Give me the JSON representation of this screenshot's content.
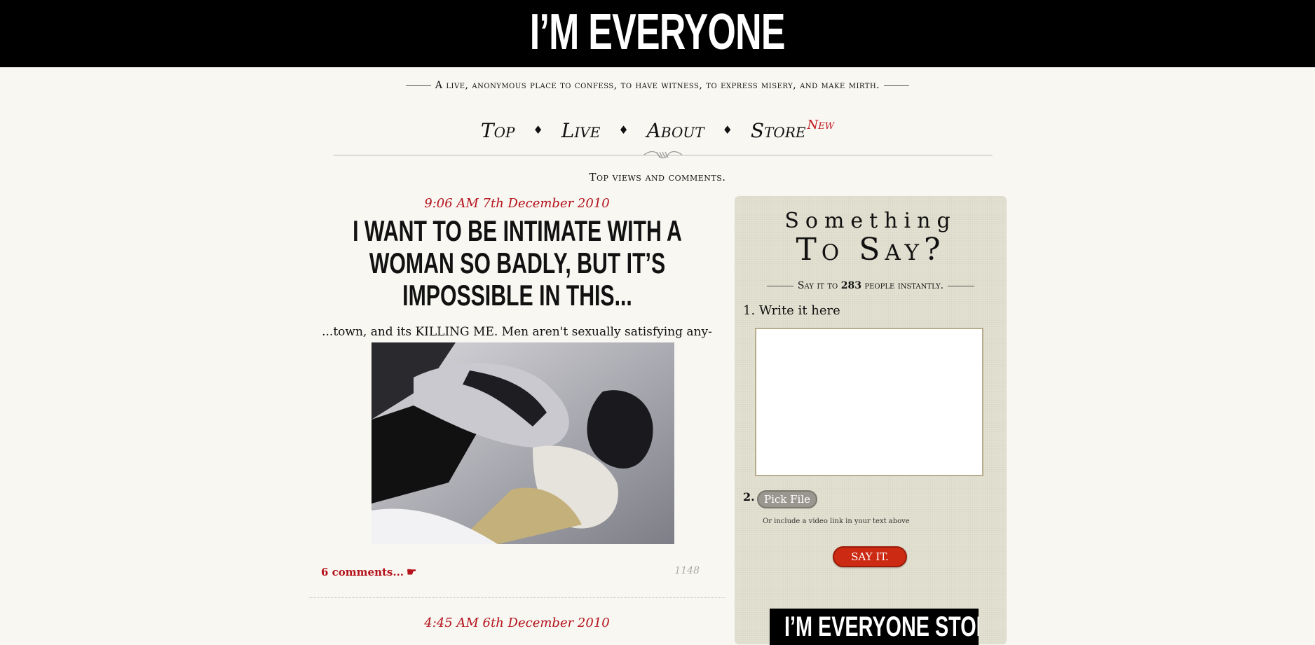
{
  "header": {
    "title": "I’M EVERYONE"
  },
  "tagline": "A live, anonymous place to confess, to have witness, to express misery, and make mirth.",
  "nav": {
    "items": [
      "Top",
      "Live",
      "About",
      "Store"
    ],
    "new_badge": "New"
  },
  "section_caption": "Top views and comments.",
  "post": {
    "time": "9:06 AM 7th December 2010",
    "title": "I WANT TO BE INTIMATE WITH A WOMAN SO BADLY, BUT IT’S IMPOSSIBLE IN THIS...",
    "body": "...town, and its KILLING ME. Men aren't sexually satisfying any-more...",
    "comments_label": "6 comments...",
    "views": "1148"
  },
  "next_post": {
    "time": "4:45 AM 6th December 2010"
  },
  "sidebar": {
    "heading_line1": "Something",
    "heading_line2": "To Say?",
    "subheading_prefix": "Say it to",
    "people_count": "283",
    "subheading_suffix": "people instantly.",
    "step1_label": "1. Write it here",
    "step2_label": "2.",
    "pick_file_label": "Pick File",
    "hint": "Or include a video link in your text above",
    "submit_label": "SAY IT.",
    "store_banner": "I’M EVERYONE STORE"
  },
  "colors": {
    "accent": "#b5121b",
    "background": "#f8f7f2",
    "sidebar": "#e3e1d1",
    "button": "#cc2a12"
  }
}
